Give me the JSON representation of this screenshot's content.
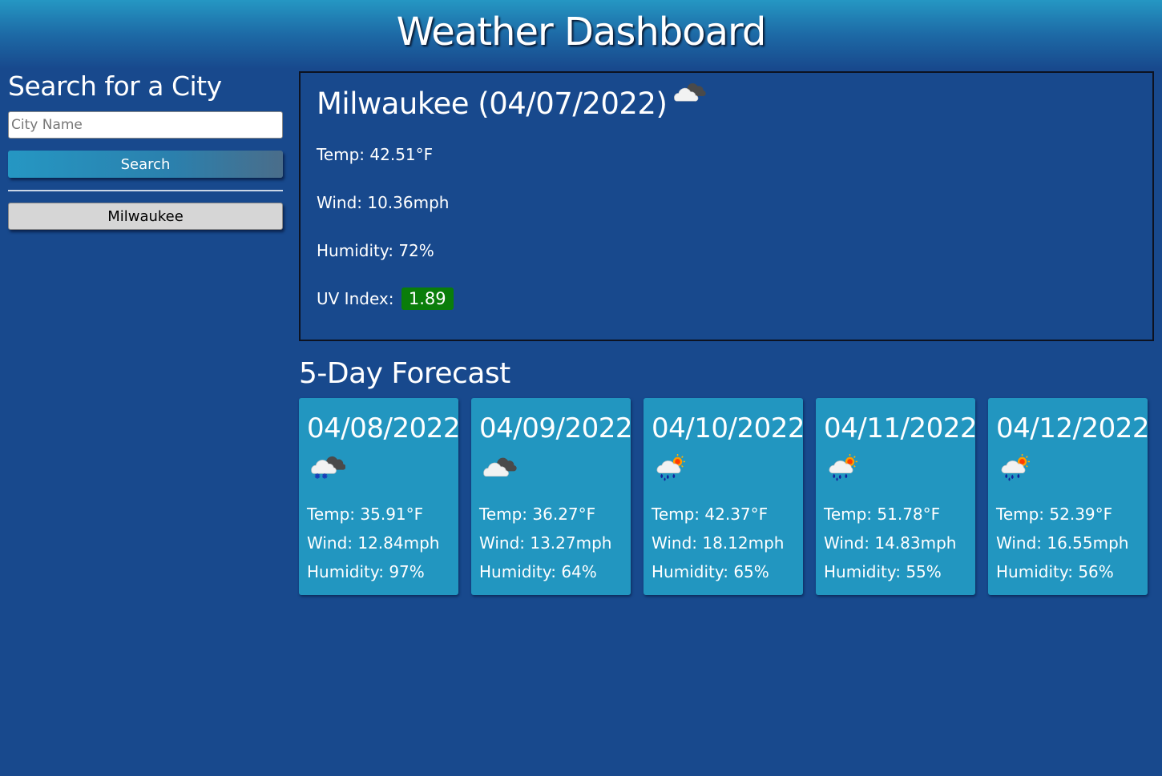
{
  "header": {
    "title": "Weather Dashboard"
  },
  "sidebar": {
    "heading": "Search for a City",
    "input_placeholder": "City Name",
    "input_value": "",
    "search_label": "Search",
    "history": [
      "Milwaukee"
    ]
  },
  "current": {
    "title": "Milwaukee (04/07/2022)",
    "icon": "broken-clouds-icon",
    "temp": "Temp: 42.51°F",
    "wind": "Wind: 10.36mph",
    "humidity": "Humidity: 72%",
    "uv_label": "UV Index:",
    "uv_value": "1.89",
    "uv_color": "#0a7d0a"
  },
  "forecast": {
    "title": "5-Day Forecast",
    "days": [
      {
        "date": "04/08/2022",
        "icon": "snow-cloud-icon",
        "temp": "Temp: 35.91°F",
        "wind": "Wind: 12.84mph",
        "humidity": "Humidity: 97%"
      },
      {
        "date": "04/09/2022",
        "icon": "broken-clouds-icon",
        "temp": "Temp: 36.27°F",
        "wind": "Wind: 13.27mph",
        "humidity": "Humidity: 64%"
      },
      {
        "date": "04/10/2022",
        "icon": "rain-sun-icon",
        "temp": "Temp: 42.37°F",
        "wind": "Wind: 18.12mph",
        "humidity": "Humidity: 65%"
      },
      {
        "date": "04/11/2022",
        "icon": "rain-sun-icon",
        "temp": "Temp: 51.78°F",
        "wind": "Wind: 14.83mph",
        "humidity": "Humidity: 55%"
      },
      {
        "date": "04/12/2022",
        "icon": "rain-sun-icon",
        "temp": "Temp: 52.39°F",
        "wind": "Wind: 16.55mph",
        "humidity": "Humidity: 56%"
      }
    ]
  },
  "colors": {
    "background": "#18498d",
    "card": "#2296c0",
    "accent": "#2597c3",
    "uv_good": "#0a7d0a"
  }
}
